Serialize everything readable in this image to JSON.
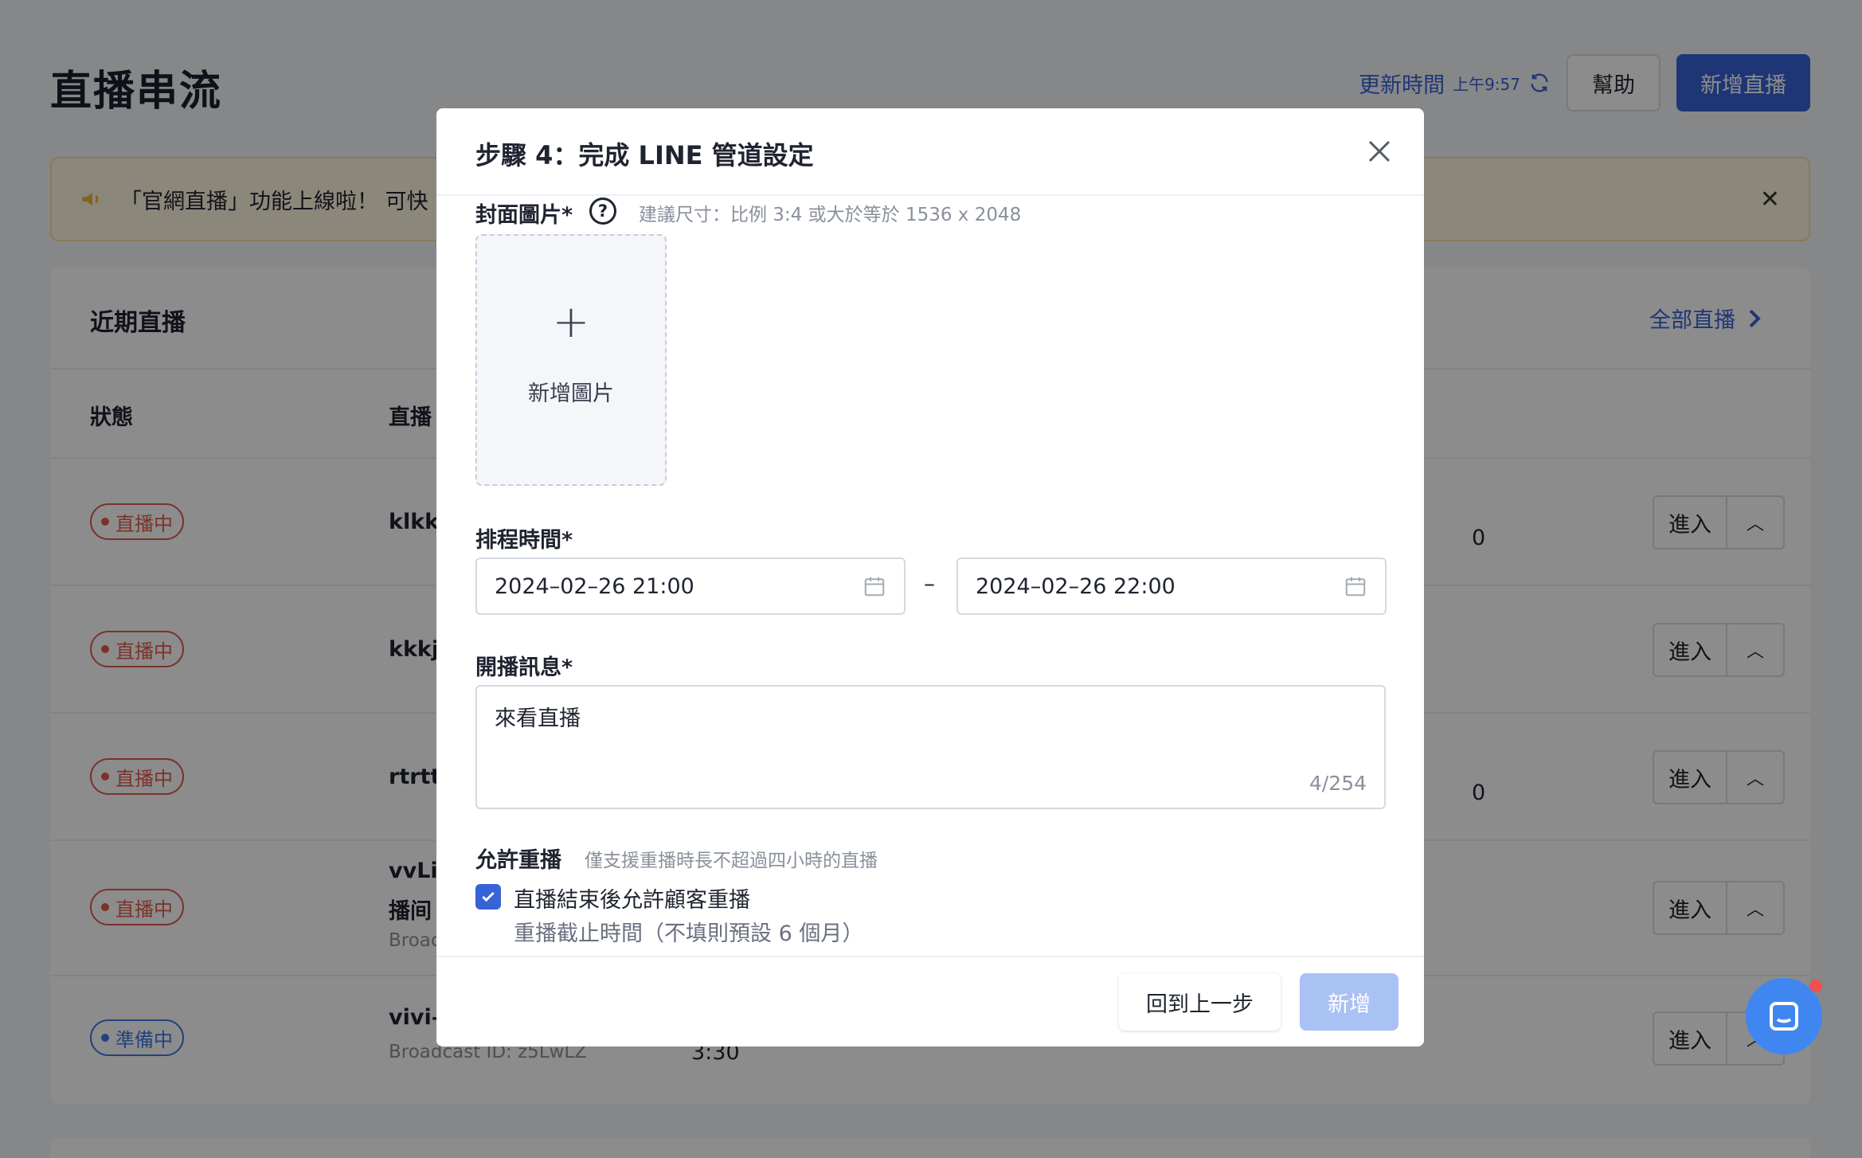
{
  "header": {
    "title": "直播串流",
    "updated_label": "更新時間",
    "updated_time": "上午9:57",
    "help_label": "幫助",
    "new_live_label": "新增直播"
  },
  "banner": {
    "text": "「官網直播」功能上線啦！ 可快"
  },
  "recent": {
    "title": "近期直播",
    "all_link": "全部直播",
    "columns": [
      "狀態",
      "直播"
    ],
    "rows": [
      {
        "status": "直播中",
        "name": "klkkk",
        "extra": "0",
        "enter": "進入"
      },
      {
        "status": "直播中",
        "name": "kkkjj",
        "extra": "",
        "enter": "進入"
      },
      {
        "status": "直播中",
        "name": "rtrttt",
        "extra": "0",
        "enter": "進入"
      },
      {
        "status": "直播中",
        "name": "vvLir",
        "name2": "播间",
        "sub": "Broac",
        "enter": "進入"
      },
      {
        "status": "準備中",
        "name": "vivi–",
        "sub": "Broadcast ID: z5LwLZ",
        "time": "3:30",
        "enter": "進入"
      }
    ]
  },
  "modal": {
    "title": "步驟 4：完成 LINE 管道設定",
    "cover": {
      "label": "封面圖片*",
      "hint": "建議尺寸：比例 3:4 或大於等於 1536 x 2048",
      "upload_text": "新增圖片",
      "help": "?"
    },
    "schedule": {
      "label": "排程時間*",
      "start": "2024–02–26 21:00",
      "end": "2024–02–26 22:00",
      "separator": "–"
    },
    "message": {
      "label": "開播訊息*",
      "value": "來看直播",
      "count": "4/254"
    },
    "replay": {
      "label": "允許重播",
      "hint": "僅支援重播時長不超過四小時的直播",
      "checkbox_label": "直播結束後允許顧客重播",
      "checked": true,
      "deadline_label": "重播截止時間（不填則預設 6 個月）"
    },
    "back_label": "回到上一步",
    "submit_label": "新增"
  },
  "colors": {
    "primary": "#3763d7",
    "live": "#e05b4b",
    "prep": "#3f7be0",
    "submit_disabled": "#a9c1f3"
  }
}
